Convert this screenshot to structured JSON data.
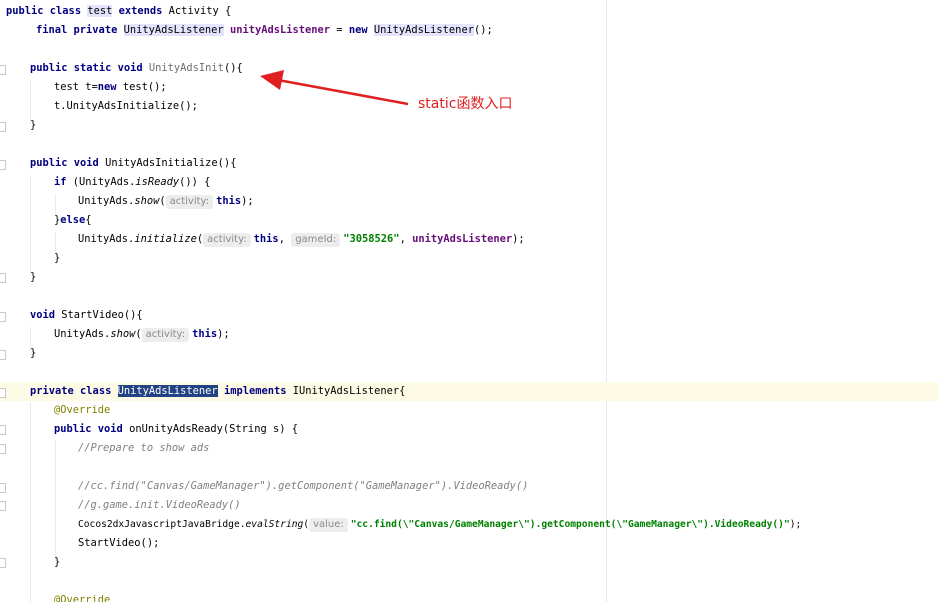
{
  "annotation": {
    "label": "static函数入口",
    "color": "#e02020"
  },
  "colors": {
    "keyword": "#000080",
    "field": "#660e7a",
    "string": "#008000",
    "comment": "#808080",
    "annotation": "#808000",
    "selection": "#214283",
    "caret_row": "#fdfbe5",
    "hint_bg": "#ededed"
  },
  "code": {
    "l1": {
      "k1": "public class ",
      "cls": "test",
      "k2": " extends ",
      "rest": "Activity {"
    },
    "l2": {
      "k1": "final private ",
      "type": "UnityAdsListener",
      "sp": " ",
      "field": "unityAdsListener",
      "eq": " = ",
      "k2": "new ",
      "ctor": "UnityAdsListener",
      "end": "();"
    },
    "l3": {
      "k1": "public static void ",
      "name": "UnityAdsInit",
      "end": "(){"
    },
    "l4": {
      "a": "test t=",
      "k1": "new ",
      "b": "test();"
    },
    "l5": {
      "text": "t.UnityAdsInitialize();"
    },
    "l6": {
      "text": "}"
    },
    "l7": {
      "k1": "public void ",
      "rest": "UnityAdsInitialize(){"
    },
    "l8": {
      "k1": "if ",
      "a": "(UnityAds.",
      "m": "isReady",
      "b": "()) {"
    },
    "l9": {
      "a": "UnityAds.",
      "m": "show",
      "p": "(",
      "hint": "activity:",
      "k1": "this",
      "end": ");"
    },
    "l10": {
      "a": "}",
      "k1": "else",
      "b": "{"
    },
    "l11": {
      "a": "UnityAds.",
      "m": "initialize",
      "p": "(",
      "hint1": "activity:",
      "k1": "this",
      "c1": ", ",
      "hint2": "gameId:",
      "str": "\"3058526\"",
      "c2": ", ",
      "field": "unityAdsListener",
      "end": ");"
    },
    "l12": {
      "text": "}"
    },
    "l13": {
      "text": "}"
    },
    "l14": {
      "k1": "void ",
      "rest": "StartVideo(){"
    },
    "l15": {
      "a": "UnityAds.",
      "m": "show",
      "p": "(",
      "hint": "activity:",
      "k1": "this",
      "end": ");"
    },
    "l16": {
      "text": "}"
    },
    "l17": {
      "k1": "private class ",
      "sel": "UnityAdsListener",
      "k2": " implements ",
      "rest": "IUnityAdsListener{"
    },
    "l18": {
      "text": "@Override"
    },
    "l19": {
      "k1": "public void ",
      "rest": "onUnityAdsReady(String s) {"
    },
    "l20": {
      "text": "//Prepare to show ads"
    },
    "l21": {
      "text": "//cc.find(\"Canvas/GameManager\").getComponent(\"GameManager\").VideoReady()"
    },
    "l22": {
      "text": "//g.game.init.VideoReady()"
    },
    "l23": {
      "a": "Cocos2dxJavascriptJavaBridge.",
      "m": "evalString",
      "p": "(",
      "hint": "value:",
      "str": "\"cc.find(\\\"Canvas/GameManager\\\").getComponent(\\\"GameManager\\\").VideoReady()\"",
      "end": ");"
    },
    "l24": {
      "text": "StartVideo();"
    },
    "l25": {
      "text": "}"
    },
    "l26": {
      "text": "@Override"
    }
  }
}
